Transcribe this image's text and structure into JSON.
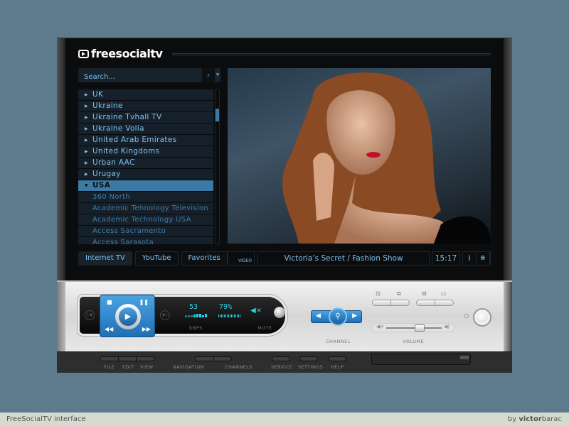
{
  "app": {
    "logo": "freesocialtv"
  },
  "search": {
    "placeholder": "Search...",
    "go_icon": "chevron-right-icon"
  },
  "channels": [
    {
      "label": "UK",
      "type": "group"
    },
    {
      "label": "Ukraine",
      "type": "group"
    },
    {
      "label": "Ukraine Tvhall TV",
      "type": "group"
    },
    {
      "label": "Ukraine Volia",
      "type": "group"
    },
    {
      "label": "United Arab Emirates",
      "type": "group"
    },
    {
      "label": "United Kingdoms",
      "type": "group"
    },
    {
      "label": "Urban AAC",
      "type": "group"
    },
    {
      "label": "Urugay",
      "type": "group"
    },
    {
      "label": "USA",
      "type": "group",
      "expanded": true,
      "selected": true
    },
    {
      "label": "360 North",
      "type": "channel"
    },
    {
      "label": "Academic Tehnology Television",
      "type": "channel"
    },
    {
      "label": "Academic Technology USA",
      "type": "channel"
    },
    {
      "label": "Access Sacramento",
      "type": "channel"
    },
    {
      "label": "Access Sarasota",
      "type": "channel"
    }
  ],
  "tabs": [
    {
      "label": "Internet TV",
      "active": true
    },
    {
      "label": "YouTube"
    },
    {
      "label": "Favorites"
    }
  ],
  "screen_bar": {
    "video_label": "VIDEO",
    "now_playing": "Victoria’s Secret / Fashion Show",
    "time": "15:17",
    "icons": [
      "equalizer-icon",
      "waveform-icon"
    ]
  },
  "player": {
    "kbps": "53",
    "kbps_label": "KBPS",
    "buffer": "79%",
    "mute_label": "MUTE",
    "channel_label": "CHANNEL",
    "volume_label": "VOLUME",
    "volume_level": 0.6
  },
  "menu": {
    "file": "FILE",
    "edit": "EDIT",
    "view": "VIEW",
    "navigation": "NAVIGATION",
    "channels": "CHANNELS",
    "service": "SERVICE",
    "settings": "SETTINGS",
    "help": "HELP"
  },
  "footer": {
    "left": "FreeSocialTV interface",
    "right_prefix": "by ",
    "right_bold": "victor",
    "right_suffix": "barac"
  },
  "colors": {
    "accent": "#3d7aa3",
    "text": "#7fc0ee",
    "lcd": "#27d4e6",
    "button_blue": "#2f86cc"
  }
}
